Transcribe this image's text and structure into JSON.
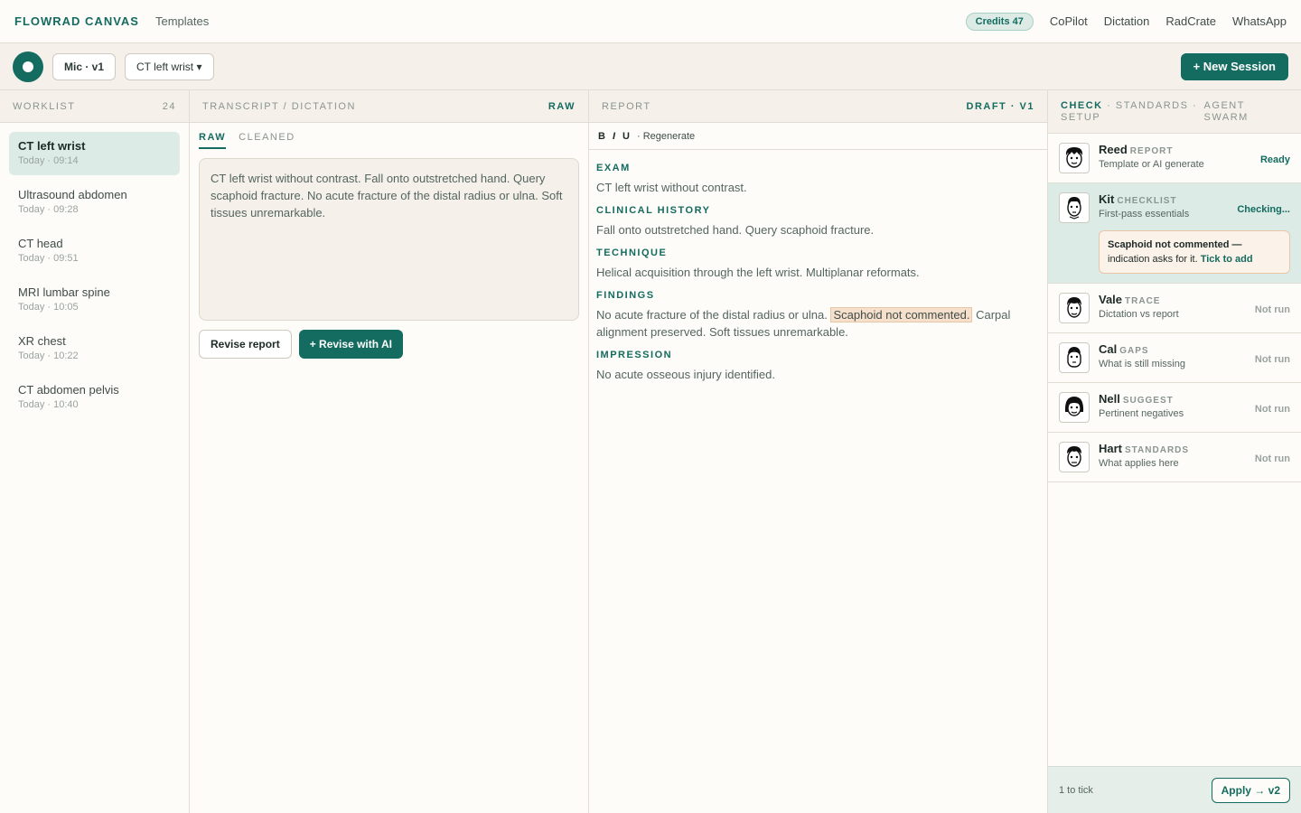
{
  "topbar": {
    "brand": "FLOWRAD CANVAS",
    "templates": "Templates",
    "credits": "Credits 47",
    "links": [
      "CoPilot",
      "Dictation",
      "RadCrate",
      "WhatsApp"
    ]
  },
  "toolbar": {
    "mic": "Mic · v1",
    "study_select": "CT left wrist ▾",
    "new_session": "+ New Session"
  },
  "worklist": {
    "heading": "WORKLIST",
    "count": "24",
    "items": [
      {
        "title": "CT left wrist",
        "time": "Today · 09:14"
      },
      {
        "title": "Ultrasound abdomen",
        "time": "Today · 09:28"
      },
      {
        "title": "CT head",
        "time": "Today · 09:51"
      },
      {
        "title": "MRI lumbar spine",
        "time": "Today · 10:05"
      },
      {
        "title": "XR chest",
        "time": "Today · 10:22"
      },
      {
        "title": "CT abdomen pelvis",
        "time": "Today · 10:40"
      }
    ]
  },
  "transcript": {
    "heading": "TRANSCRIPT / DICTATION",
    "mode": "RAW",
    "tabs": [
      "RAW",
      "CLEANED"
    ],
    "text": "CT left wrist without contrast. Fall onto outstretched hand. Query scaphoid fracture. No acute fracture of the distal radius or ulna. Soft tissues unremarkable.",
    "revise_label": "Revise report",
    "revise_ai_label": "+ Revise with AI"
  },
  "report": {
    "heading": "REPORT",
    "status": "DRAFT · V1",
    "format": {
      "bold": "B",
      "italic": "I",
      "underline": "U",
      "regenerate": "· Regenerate"
    },
    "sections": {
      "exam": {
        "title": "EXAM",
        "text": "CT left wrist without contrast."
      },
      "history": {
        "title": "CLINICAL HISTORY",
        "text": "Fall onto outstretched hand. Query scaphoid fracture."
      },
      "technique": {
        "title": "TECHNIQUE",
        "text": "Helical acquisition through the left wrist. Multiplanar reformats."
      },
      "findings": {
        "title": "FINDINGS",
        "text_before": "No acute fracture of the distal radius or ulna.",
        "highlight": "Scaphoid not commented.",
        "text_after": "Carpal alignment preserved. Soft tissues unremarkable."
      },
      "impression": {
        "title": "IMPRESSION",
        "text": "No acute osseous injury identified."
      }
    }
  },
  "agents_panel": {
    "tab_active": "CHECK",
    "tab_standards": " · STANDARDS · SETUP",
    "tab_swarm": "AGENT SWARM",
    "agents": [
      {
        "name": "Reed",
        "role": "REPORT",
        "desc": "Template or AI generate",
        "status": "Ready"
      },
      {
        "name": "Kit",
        "role": "CHECKLIST",
        "desc": "First-pass essentials",
        "status": "Checking..."
      },
      {
        "name": "Vale",
        "role": "TRACE",
        "desc": "Dictation vs report",
        "status": "Not run"
      },
      {
        "name": "Cal",
        "role": "GAPS",
        "desc": "What is still missing",
        "status": "Not run"
      },
      {
        "name": "Nell",
        "role": "SUGGEST",
        "desc": "Pertinent negatives",
        "status": "Not run"
      },
      {
        "name": "Hart",
        "role": "STANDARDS",
        "desc": "What applies here",
        "status": "Not run"
      }
    ],
    "alert": {
      "strong": "Scaphoid not commented —",
      "text": "indication asks for it.",
      "link": "Tick to add"
    },
    "footer_text": "1 to tick",
    "apply_label": "Apply → v2"
  },
  "colors": {
    "accent": "#146b60",
    "highlight": "#f6e0cc",
    "panel": "#f5f1ea"
  }
}
